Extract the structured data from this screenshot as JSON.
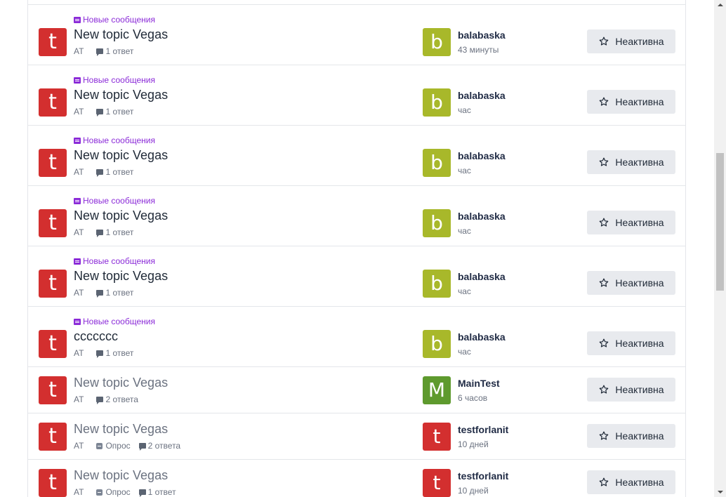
{
  "colors": {
    "topic_avatar": "#d32f2f",
    "user_b": "#a8b82a",
    "user_m": "#5e9a2e",
    "user_t": "#d32f2f",
    "new_tag": "#8b2bd8"
  },
  "topics": [
    {
      "tag": "Новые сообщения",
      "title": "New topic Vegas",
      "letter": "t",
      "category": "AT",
      "poll": "",
      "replies": "1 ответ",
      "user_letter": "b",
      "user_color": "#a8b82a",
      "username": "balabaska",
      "time": "43 минуты",
      "follow": "Неактивна"
    },
    {
      "tag": "Новые сообщения",
      "title": "New topic Vegas",
      "letter": "t",
      "category": "AT",
      "poll": "",
      "replies": "1 ответ",
      "user_letter": "b",
      "user_color": "#a8b82a",
      "username": "balabaska",
      "time": "час",
      "follow": "Неактивна"
    },
    {
      "tag": "Новые сообщения",
      "title": "New topic Vegas",
      "letter": "t",
      "category": "AT",
      "poll": "",
      "replies": "1 ответ",
      "user_letter": "b",
      "user_color": "#a8b82a",
      "username": "balabaska",
      "time": "час",
      "follow": "Неактивна"
    },
    {
      "tag": "Новые сообщения",
      "title": "New topic Vegas",
      "letter": "t",
      "category": "AT",
      "poll": "",
      "replies": "1 ответ",
      "user_letter": "b",
      "user_color": "#a8b82a",
      "username": "balabaska",
      "time": "час",
      "follow": "Неактивна"
    },
    {
      "tag": "Новые сообщения",
      "title": "New topic Vegas",
      "letter": "t",
      "category": "AT",
      "poll": "",
      "replies": "1 ответ",
      "user_letter": "b",
      "user_color": "#a8b82a",
      "username": "balabaska",
      "time": "час",
      "follow": "Неактивна"
    },
    {
      "tag": "Новые сообщения",
      "title": "ccccccc",
      "letter": "t",
      "category": "AT",
      "poll": "",
      "replies": "1 ответ",
      "user_letter": "b",
      "user_color": "#a8b82a",
      "username": "balabaska",
      "time": "час",
      "follow": "Неактивна"
    },
    {
      "tag": "",
      "title": "New topic Vegas",
      "letter": "t",
      "category": "AT",
      "poll": "",
      "replies": "2 ответа",
      "user_letter": "M",
      "user_color": "#5e9a2e",
      "username": "MainTest",
      "time": "6 часов",
      "follow": "Неактивна"
    },
    {
      "tag": "",
      "title": "New topic Vegas",
      "letter": "t",
      "category": "AT",
      "poll": "Опрос",
      "replies": "2 ответа",
      "user_letter": "t",
      "user_color": "#d32f2f",
      "username": "testforlanit",
      "time": "10 дней",
      "follow": "Неактивна"
    },
    {
      "tag": "",
      "title": "New topic Vegas",
      "letter": "t",
      "category": "AT",
      "poll": "Опрос",
      "replies": "1 ответ",
      "user_letter": "t",
      "user_color": "#d32f2f",
      "username": "testforlanit",
      "time": "10 дней",
      "follow": "Неактивна"
    }
  ]
}
